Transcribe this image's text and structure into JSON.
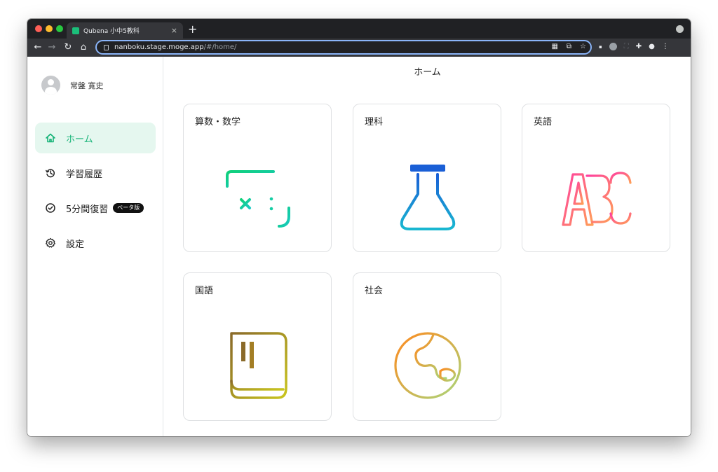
{
  "browser": {
    "tab_title": "Qubena 小中5教科",
    "tab_close": "×",
    "new_tab": "+",
    "url_host": "nanboku.stage.moge.app",
    "url_path": "/#/home/"
  },
  "sidebar": {
    "user_name": "常盤 寛史",
    "items": [
      {
        "label": "ホーム",
        "icon": "home-icon",
        "active": true
      },
      {
        "label": "学習履歴",
        "icon": "history-icon",
        "active": false
      },
      {
        "label": "5分間復習",
        "icon": "check-circle-icon",
        "active": false,
        "badge": "ベータ版"
      },
      {
        "label": "設定",
        "icon": "gear-icon",
        "active": false
      }
    ]
  },
  "main": {
    "title": "ホーム",
    "subjects": [
      {
        "label": "算数・数学",
        "icon": "math-icon"
      },
      {
        "label": "理科",
        "icon": "flask-icon"
      },
      {
        "label": "英語",
        "icon": "abc-icon"
      },
      {
        "label": "国語",
        "icon": "book-icon"
      },
      {
        "label": "社会",
        "icon": "globe-icon"
      }
    ]
  },
  "colors": {
    "accent_green": "#15b377",
    "active_bg": "#e5f7ef",
    "math_gradient": [
      "#0fd07a",
      "#18c9c3"
    ],
    "science_gradient": [
      "#1a5fd6",
      "#19b7d1"
    ],
    "english_gradient": [
      "#ff3fa0",
      "#ff9e57"
    ],
    "japanese_gradient": [
      "#8a6a2a",
      "#c9c51e"
    ],
    "social_gradient": [
      "#ff8a1f",
      "#a8d67a"
    ]
  }
}
